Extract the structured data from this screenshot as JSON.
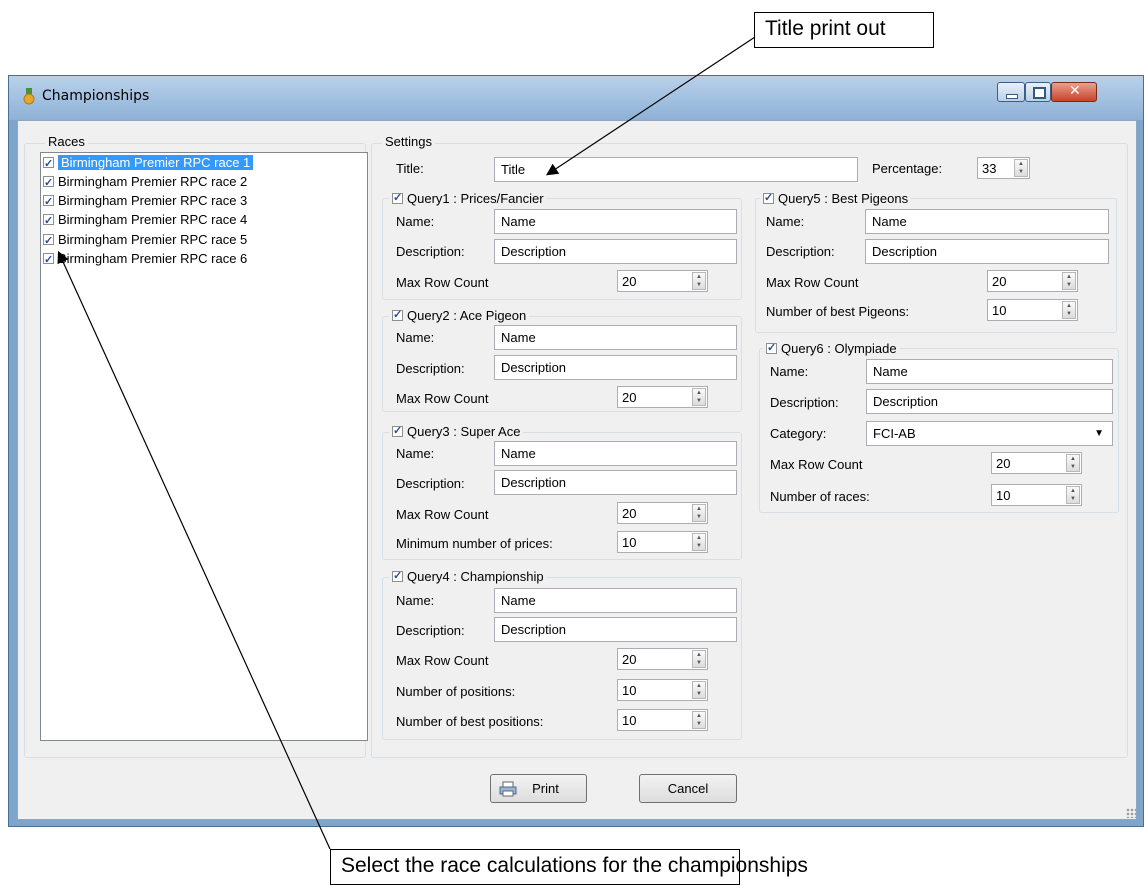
{
  "callouts": {
    "top": "Title print out",
    "bottom": "Select the race calculations for the championships"
  },
  "window": {
    "title": "Championships",
    "icon": "medal-icon"
  },
  "races_group": {
    "label": "Races",
    "items": [
      "Birmingham Premier RPC race 1",
      "Birmingham Premier RPC race 2",
      "Birmingham Premier RPC race 3",
      "Birmingham Premier RPC race 4",
      "Birmingham Premier RPC race 5",
      "Birmingham Premier RPC race 6"
    ]
  },
  "settings": {
    "label": "Settings",
    "title_label": "Title:",
    "title_value": "Title",
    "percentage_label": "Percentage:",
    "percentage_value": "33"
  },
  "q1": {
    "header": "Query1 : Prices/Fancier",
    "name_label": "Name:",
    "name": "Name",
    "desc_label": "Description:",
    "desc": "Description",
    "max_label": "Max Row Count",
    "max": "20"
  },
  "q2": {
    "header": "Query2 : Ace Pigeon",
    "name_label": "Name:",
    "name": "Name",
    "desc_label": "Description:",
    "desc": "Description",
    "max_label": "Max Row Count",
    "max": "20"
  },
  "q3": {
    "header": "Query3 : Super Ace",
    "name_label": "Name:",
    "name": "Name",
    "desc_label": "Description:",
    "desc": "Description",
    "max_label": "Max Row Count",
    "max": "20",
    "min_label": "Minimum number of prices:",
    "min": "10"
  },
  "q4": {
    "header": "Query4 : Championship",
    "name_label": "Name:",
    "name": "Name",
    "desc_label": "Description:",
    "desc": "Description",
    "max_label": "Max Row Count",
    "max": "20",
    "pos_label": "Number of positions:",
    "pos": "10",
    "best_label": "Number of best positions:",
    "best": "10"
  },
  "q5": {
    "header": "Query5 : Best Pigeons",
    "name_label": "Name:",
    "name": "Name",
    "desc_label": "Description:",
    "desc": "Description",
    "max_label": "Max Row Count",
    "max": "20",
    "best_label": "Number of best Pigeons:",
    "best": "10"
  },
  "q6": {
    "header": "Query6 : Olympiade",
    "name_label": "Name:",
    "name": "Name",
    "desc_label": "Description:",
    "desc": "Description",
    "cat_label": "Category:",
    "cat": "FCI-AB",
    "max_label": "Max Row Count",
    "max": "20",
    "races_label": "Number of races:",
    "races": "10"
  },
  "buttons": {
    "print": "Print",
    "cancel": "Cancel"
  }
}
